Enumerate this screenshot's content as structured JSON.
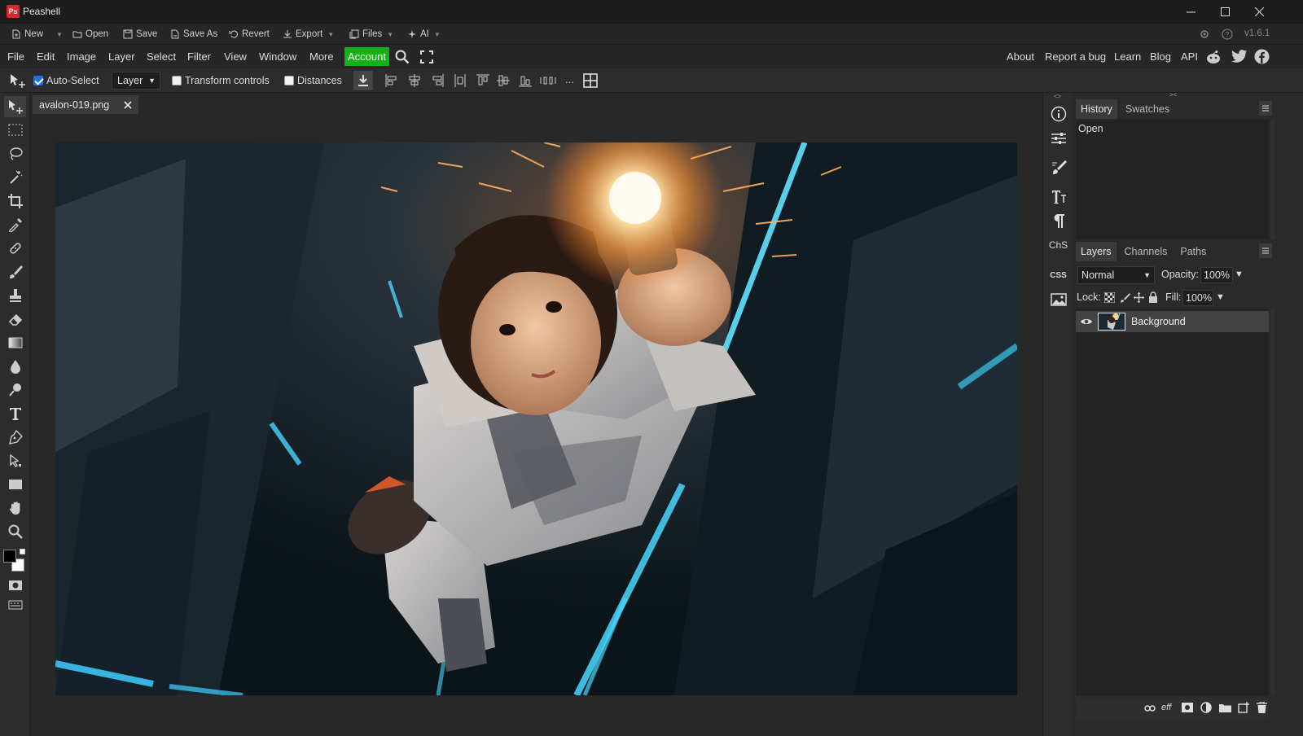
{
  "app": {
    "title": "Peashell",
    "logo_text": "Ps",
    "version": "v1.6.1"
  },
  "filebar": {
    "items": [
      {
        "label": "New",
        "icon": "new-file-icon",
        "dropdown": true
      },
      {
        "label": "Open",
        "icon": "folder-open-icon",
        "dropdown": false
      },
      {
        "label": "Save",
        "icon": "save-icon",
        "dropdown": false
      },
      {
        "label": "Save As",
        "icon": "save-as-icon",
        "dropdown": false
      },
      {
        "label": "Revert",
        "icon": "revert-icon",
        "dropdown": false
      },
      {
        "label": "Export",
        "icon": "export-icon",
        "dropdown": true
      },
      {
        "label": "Files",
        "icon": "files-icon",
        "dropdown": true
      },
      {
        "label": "AI",
        "icon": "ai-sparkle-icon",
        "dropdown": true
      }
    ]
  },
  "menubar": {
    "items": [
      "File",
      "Edit",
      "Image",
      "Layer",
      "Select",
      "Filter",
      "View",
      "Window",
      "More"
    ],
    "account": "Account",
    "right_links": [
      "About",
      "Report a bug",
      "Learn",
      "Blog",
      "API"
    ]
  },
  "options": {
    "auto_select": {
      "label": "Auto-Select",
      "checked": true
    },
    "layer_select_value": "Layer",
    "transform_controls": {
      "label": "Transform controls",
      "checked": false
    },
    "distances": {
      "label": "Distances",
      "checked": false
    },
    "more": "..."
  },
  "document": {
    "tab_name": "avalon-019.png"
  },
  "panels": {
    "history": {
      "tabs": [
        "History",
        "Swatches"
      ],
      "items": [
        "Open"
      ]
    },
    "layers": {
      "tabs": [
        "Layers",
        "Channels",
        "Paths"
      ],
      "blend_mode": "Normal",
      "opacity_label": "Opacity:",
      "opacity_value": "100%",
      "lock_label": "Lock:",
      "fill_label": "Fill:",
      "fill_value": "100%",
      "layers": [
        {
          "name": "Background",
          "visible": true
        }
      ]
    }
  },
  "right_icons": {
    "chs": "ChS",
    "css": "CSS"
  },
  "colors": {
    "accent_account": "#14b214",
    "checkbox_blue": "#1a73e8",
    "logo_red": "#d9272e"
  }
}
